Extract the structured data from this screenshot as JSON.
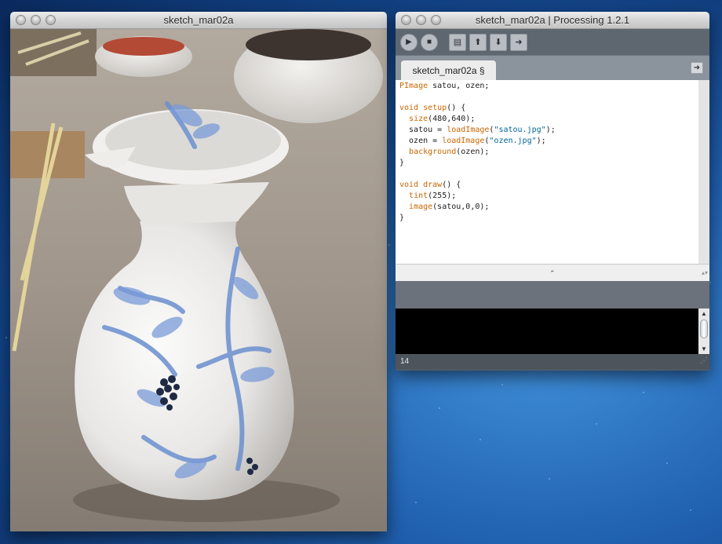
{
  "sketch_window": {
    "title": "sketch_mar02a"
  },
  "ide_window": {
    "title": "sketch_mar02a | Processing 1.2.1",
    "toolbar": {
      "run_icon": "play-icon",
      "stop_icon": "stop-icon",
      "new_icon": "document-icon",
      "open_icon": "upload-arrow-icon",
      "save_icon": "download-arrow-icon",
      "export_icon": "export-arrow-icon"
    },
    "tab_label": "sketch_mar02a §",
    "code_lines": [
      "PImage satou, ozen;",
      "",
      "void setup() {",
      "  size(480,640);",
      "  satou = loadImage(\"satou.jpg\");",
      "  ozen = loadImage(\"ozen.jpg\");",
      "  background(ozen);",
      "}",
      "",
      "void draw() {",
      "  tint(255);",
      "  image(satou,0,0);",
      "}"
    ],
    "line_number": "14"
  },
  "colors": {
    "keyword": "#cc6600",
    "string": "#006699"
  }
}
